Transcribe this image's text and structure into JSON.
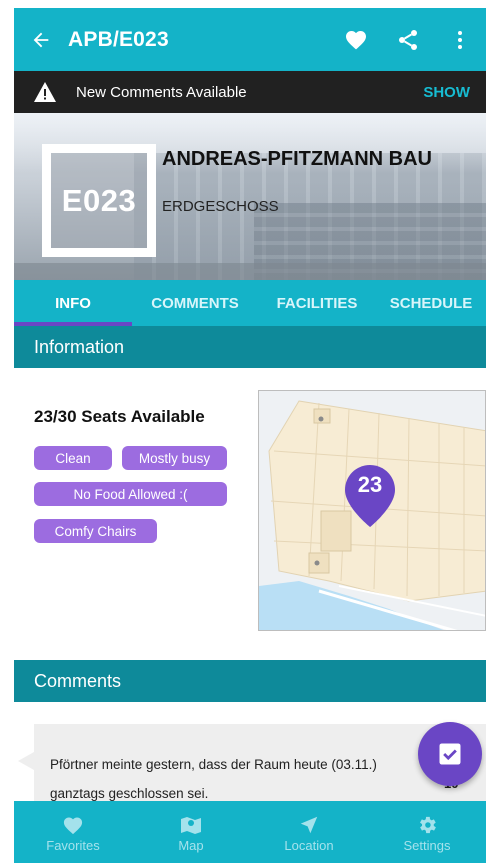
{
  "app_bar": {
    "title": "APB/E023"
  },
  "notification": {
    "message": "New Comments Available",
    "action": "SHOW"
  },
  "room": {
    "code": "E023",
    "building_name": "ANDREAS-PFITZMANN BAU",
    "floor": "ERDGESCHOSS"
  },
  "tabs": [
    {
      "label": "INFO",
      "active": true
    },
    {
      "label": "COMMENTS",
      "active": false
    },
    {
      "label": "FACILITIES",
      "active": false
    },
    {
      "label": "SCHEDULE",
      "active": false
    }
  ],
  "info": {
    "header": "Information",
    "seats": "23/30 Seats Available",
    "chips": [
      "Clean",
      "Mostly busy",
      "No Food Allowed :(",
      "Comfy Chairs"
    ],
    "map_pin": "23"
  },
  "comments": {
    "header": "Comments",
    "items": [
      {
        "text": "Pförtner meinte gestern, dass der Raum heute (03.11.) ganztags geschlossen sei.",
        "votes": "10"
      }
    ]
  },
  "bottom_nav": [
    {
      "label": "Favorites",
      "icon": "heart-icon"
    },
    {
      "label": "Map",
      "icon": "map-icon"
    },
    {
      "label": "Location",
      "icon": "navigation-arrow-icon"
    },
    {
      "label": "Settings",
      "icon": "gear-icon"
    }
  ],
  "colors": {
    "primary": "#14b3c8",
    "primary_dark": "#0e8a9a",
    "accent": "#6a46c5",
    "chip": "#9c6ce0",
    "notice_bg": "#212121"
  }
}
